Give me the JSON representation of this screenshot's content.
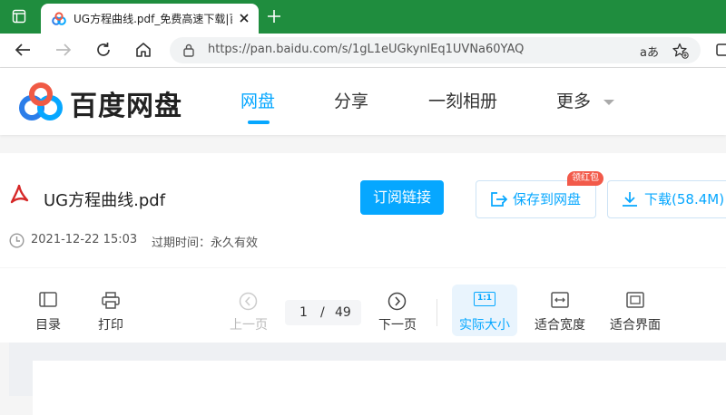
{
  "browser": {
    "tab_title": "UG方程曲线.pdf_免费高速下载|百",
    "url": "https://pan.baidu.com/s/1gL1eUGkynlEq1UVNa60YAQ",
    "accent": "#1f8d3e"
  },
  "site": {
    "logo_text": "百度网盘",
    "nav": {
      "netdisk": "网盘",
      "share": "分享",
      "album": "一刻相册",
      "more": "更多"
    },
    "accent": "#06a7ff"
  },
  "file": {
    "name": "UG方程曲线.pdf",
    "subscribe_label": "订阅链接",
    "save_label": "保存到网盘",
    "save_badge": "领红包",
    "download_label": "下载(58.4M)",
    "date": "2021-12-22 15:03",
    "expire_label": "过期时间：永久有效"
  },
  "viewer": {
    "toc_label": "目录",
    "print_label": "打印",
    "prev_label": "上一页",
    "current_page": "1",
    "page_separator": "/",
    "total_pages": "49",
    "next_label": "下一页",
    "actual_size_label": "实际大小",
    "actual_size_icon_text": "1:1",
    "fit_width_label": "适合宽度",
    "fit_page_label": "适合界面"
  }
}
